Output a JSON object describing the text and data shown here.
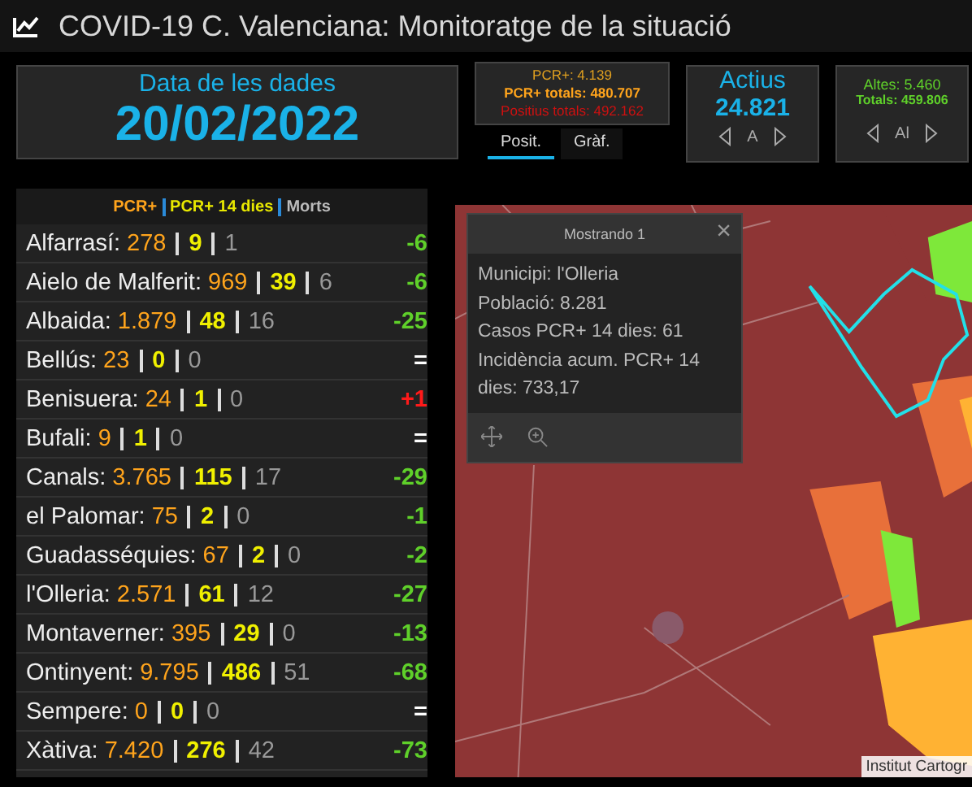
{
  "window": {
    "title": "COVID-19 C. Valenciana: Monitoratge de la situació"
  },
  "date_panel": {
    "label": "Data de les dades",
    "value": "20/02/2022"
  },
  "positives_panel": {
    "pcr": "PCR+: 4.139",
    "pcr_total": "PCR+ totals: 480.707",
    "positive_total": "Positius totals: 492.162"
  },
  "tabs": [
    {
      "label": "Posit.",
      "selected": true
    },
    {
      "label": "Gràf.",
      "selected": false
    }
  ],
  "active_panel": {
    "label": "Actius",
    "value": "24.821",
    "pager": "A"
  },
  "discharges_panel": {
    "value": "Altes: 5.460",
    "total": "Totals: 459.806",
    "pager": "Al"
  },
  "list_header": [
    "PCR+",
    "PCR+ 14 dies",
    "Morts"
  ],
  "municipalities": [
    {
      "name": "Alfarrasí:",
      "pcr": "278",
      "pcr14": "9",
      "deaths": "1",
      "change": "-6",
      "color": "#5fd02a"
    },
    {
      "name": "Aielo de Malferit:",
      "pcr": "969",
      "pcr14": "39",
      "deaths": "6",
      "change": "-6",
      "color": "#5fd02a"
    },
    {
      "name": "Albaida:",
      "pcr": "1.879",
      "pcr14": "48",
      "deaths": "16",
      "change": "-25",
      "color": "#5fd02a"
    },
    {
      "name": "Bellús:",
      "pcr": "23",
      "pcr14": "0",
      "deaths": "0",
      "change": "=",
      "color": "#ffffff"
    },
    {
      "name": "Benisuera:",
      "pcr": "24",
      "pcr14": "1",
      "deaths": "0",
      "change": "+1",
      "color": "#ff1a1a"
    },
    {
      "name": "Bufali:",
      "pcr": "9",
      "pcr14": "1",
      "deaths": "0",
      "change": "=",
      "color": "#ffffff"
    },
    {
      "name": "Canals:",
      "pcr": "3.765",
      "pcr14": "115",
      "deaths": "17",
      "change": "-29",
      "color": "#5fd02a"
    },
    {
      "name": "el Palomar:",
      "pcr": "75",
      "pcr14": "2",
      "deaths": "0",
      "change": "-1",
      "color": "#5fd02a"
    },
    {
      "name": "Guadasséquies:",
      "pcr": "67",
      "pcr14": "2",
      "deaths": "0",
      "change": "-2",
      "color": "#5fd02a"
    },
    {
      "name": "l'Olleria:",
      "pcr": "2.571",
      "pcr14": "61",
      "deaths": "12",
      "change": "-27",
      "color": "#5fd02a"
    },
    {
      "name": "Montaverner:",
      "pcr": "395",
      "pcr14": "29",
      "deaths": "0",
      "change": "-13",
      "color": "#5fd02a"
    },
    {
      "name": "Ontinyent:",
      "pcr": "9.795",
      "pcr14": "486",
      "deaths": "51",
      "change": "-68",
      "color": "#5fd02a"
    },
    {
      "name": "Sempere:",
      "pcr": "0",
      "pcr14": "0",
      "deaths": "0",
      "change": "=",
      "color": "#ffffff"
    },
    {
      "name": "Xàtiva:",
      "pcr": "7.420",
      "pcr14": "276",
      "deaths": "42",
      "change": "-73",
      "color": "#5fd02a"
    }
  ],
  "map": {
    "kind": "picture",
    "attribution": "Institut Cartogr",
    "popup": {
      "title": "Mostrando 1",
      "close": "×",
      "lines": [
        "Municipi: l'Olleria",
        "Població: 8.281",
        "Casos PCR+ 14 dies: 61",
        "Incidència acum. PCR+ 14 dies: 733,17"
      ]
    }
  }
}
